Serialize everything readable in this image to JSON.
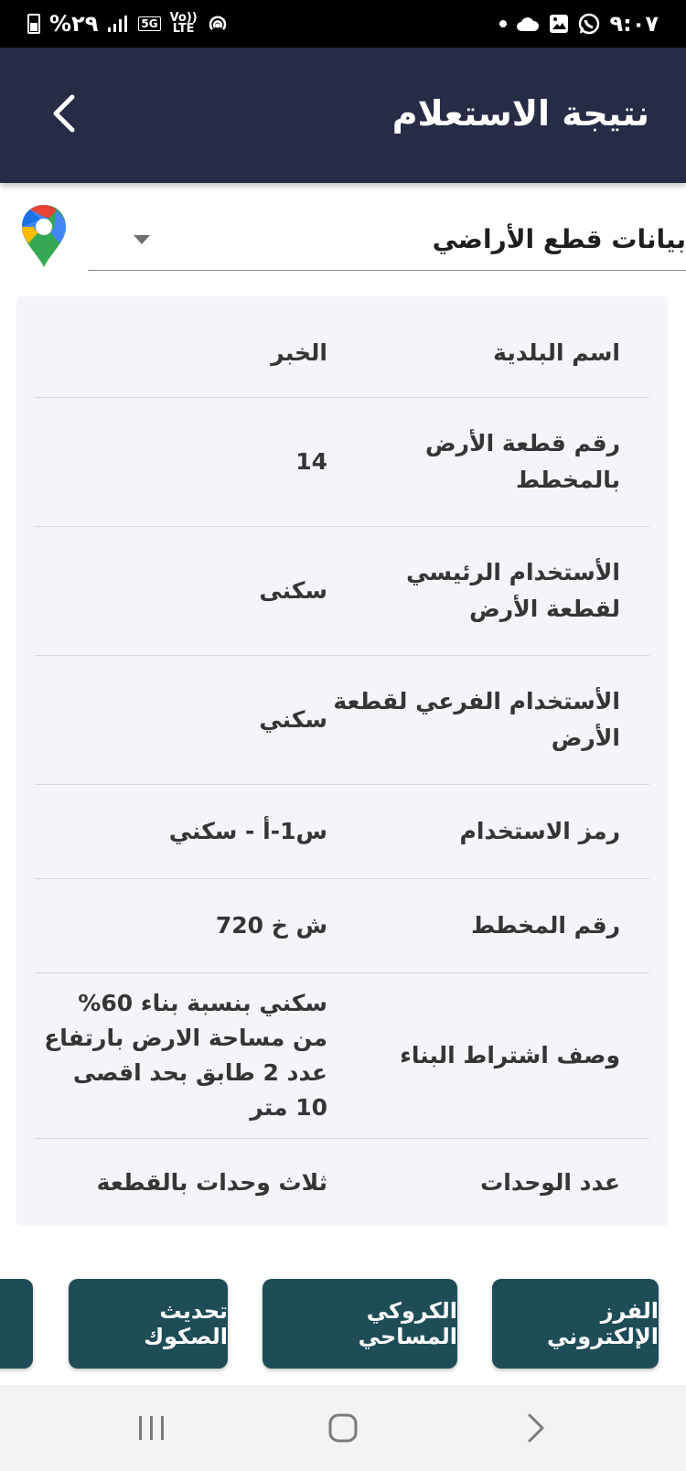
{
  "status_bar": {
    "time": "٩:٠٧",
    "battery": "%٢٩",
    "network_5g": "5G",
    "volte_top": "Vo))",
    "volte_bottom": "LTE"
  },
  "header": {
    "title": "نتيجة الاستعلام"
  },
  "section_selector": {
    "selected": "بيانات قطع الأراضي"
  },
  "details": [
    {
      "label": "اسم البلدية",
      "value": "الخبر"
    },
    {
      "label": "رقم قطعة الأرض بالمخطط",
      "value": "14"
    },
    {
      "label": "الأستخدام الرئيسي لقطعة الأرض",
      "value": "سكنى"
    },
    {
      "label": "الأستخدام الفرعي لقطعة الأرض",
      "value": "سكني"
    },
    {
      "label": "رمز الاستخدام",
      "value": "س1-أ - سكني"
    },
    {
      "label": "رقم المخطط",
      "value": "ش خ 720"
    },
    {
      "label": "وصف اشتراط البناء",
      "value": "سكني بنسبة بناء 60% من مساحة الارض بارتفاع عدد 2 طابق بحد اقصى 10 متر"
    },
    {
      "label": "عدد الوحدات",
      "value": "ثلاث وحدات بالقطعة"
    }
  ],
  "actions": [
    {
      "label": "الفرز الإلكتروني"
    },
    {
      "label": "الكروكي المساحي"
    },
    {
      "label": "تحديث الصكوك"
    }
  ],
  "colors": {
    "app_bar": "#262b46",
    "action_button": "#1e4d58",
    "card_background": "#f4f5f9"
  }
}
